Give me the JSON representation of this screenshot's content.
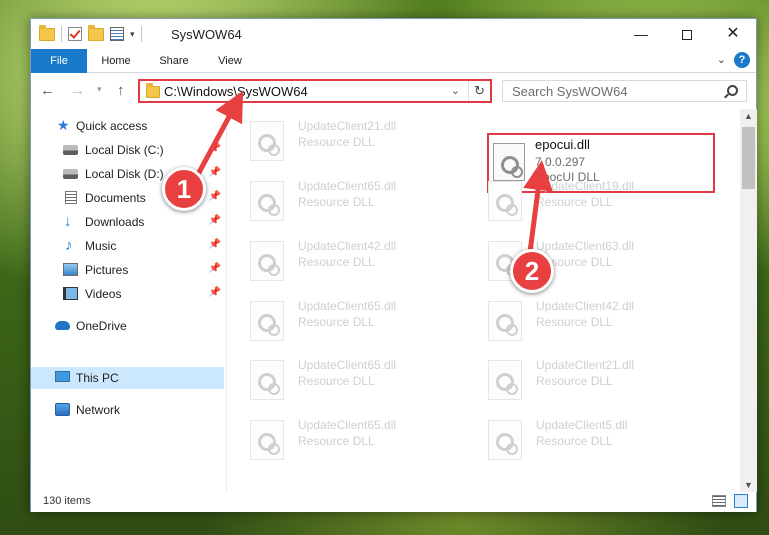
{
  "window": {
    "title": "SysWOW64",
    "minimize_icon": "minimize-icon",
    "maximize_icon": "maximize-icon",
    "close_icon": "close-icon"
  },
  "ribbon": {
    "tabs": [
      {
        "label": "File"
      },
      {
        "label": "Home"
      },
      {
        "label": "Share"
      },
      {
        "label": "View"
      }
    ],
    "help_label": "?"
  },
  "address_bar": {
    "path": "C:\\Windows\\SysWOW64",
    "refresh_icon": "refresh-icon"
  },
  "search": {
    "placeholder": "Search SysWOW64"
  },
  "sidebar": {
    "items": [
      {
        "label": "Quick access",
        "icon": "quick-access-star-icon"
      },
      {
        "label": "Local Disk (C:)",
        "icon": "drive-icon",
        "pinned": true
      },
      {
        "label": "Local Disk (D:)",
        "icon": "drive-icon",
        "pinned": true
      },
      {
        "label": "Documents",
        "icon": "documents-icon",
        "pinned": true
      },
      {
        "label": "Downloads",
        "icon": "downloads-icon",
        "pinned": true
      },
      {
        "label": "Music",
        "icon": "music-icon",
        "pinned": true
      },
      {
        "label": "Pictures",
        "icon": "pictures-icon",
        "pinned": true
      },
      {
        "label": "Videos",
        "icon": "videos-icon",
        "pinned": true
      },
      {
        "label": "OneDrive",
        "icon": "onedrive-icon"
      },
      {
        "label": "This PC",
        "icon": "this-pc-icon",
        "selected": true
      },
      {
        "label": "Network",
        "icon": "network-icon"
      }
    ]
  },
  "files": {
    "selected": {
      "name": "epocui.dll",
      "version": "7.0.0.297",
      "description": "EpocUI DLL"
    },
    "left_column": [
      {
        "name": "UpdateClient21.dll",
        "type": "Resource DLL"
      },
      {
        "name": "UpdateClient65.dll",
        "type": "Resource DLL"
      },
      {
        "name": "UpdateClient42.dll",
        "type": "Resource DLL"
      },
      {
        "name": "UpdateClient65.dll",
        "type": "Resource DLL"
      },
      {
        "name": "UpdateClient65.dll",
        "type": "Resource DLL"
      },
      {
        "name": "UpdateClient65.dll",
        "type": "Resource DLL"
      }
    ],
    "right_column": [
      {
        "name": "UpdateClient19.dll",
        "type": "Resource DLL"
      },
      {
        "name": "UpdateClient63.dll",
        "type": "Resource DLL"
      },
      {
        "name": "UpdateClient42.dll",
        "type": "Resource DLL"
      },
      {
        "name": "UpdateClient21.dll",
        "type": "Resource DLL"
      },
      {
        "name": "UpdateClient5.dll",
        "type": "Resource DLL"
      }
    ]
  },
  "status_bar": {
    "item_count": "130 items"
  },
  "annotations": {
    "badge_1": "1",
    "badge_2": "2",
    "highlight_color": "#e03a44"
  }
}
